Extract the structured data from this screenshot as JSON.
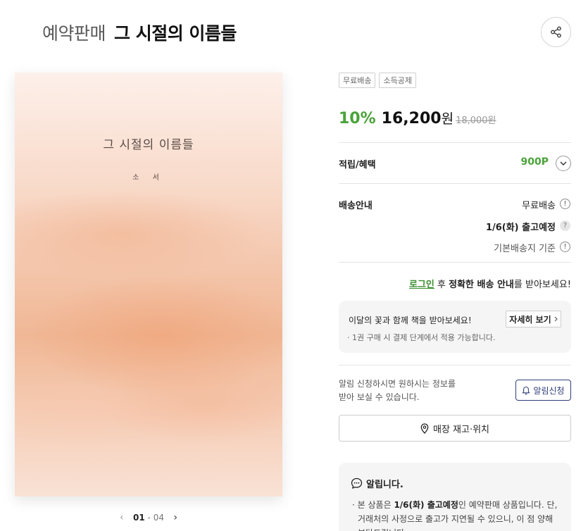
{
  "header": {
    "prefix": "예약판매",
    "title": "그 시절의 이름들"
  },
  "cover": {
    "title": "그 시절의 이름들",
    "author": "소 서"
  },
  "pager": {
    "current": "01",
    "separator": "-",
    "total": "04"
  },
  "badges": [
    "무료배송",
    "소득공제"
  ],
  "price": {
    "discount": "10%",
    "sale": "16,200",
    "currency": "원",
    "original": "18,000원"
  },
  "points": {
    "label": "적립/혜택",
    "value": "900P"
  },
  "shipping": {
    "label": "배송안내",
    "fee": "무료배송",
    "date": "1/6(화) 출고예정",
    "base": "기본배송지 기준"
  },
  "login_notice": {
    "link": "로그인",
    "after": "후",
    "bold": "정확한 배송 안내",
    "tail": "를 받아보세요!"
  },
  "flower": {
    "title": "이달의 꽃과 함께 책을 받아보세요!",
    "note": "· 1권 구매 시 결제 단계에서 적용 가능합니다.",
    "button": "자세히 보기"
  },
  "alarm": {
    "line1": "알림 신청하시면 원하시는 정보를",
    "line2": "받아 보실 수 있습니다.",
    "button": "알림신청"
  },
  "store": {
    "button": "매장 재고·위치"
  },
  "notice": {
    "title": "알립니다.",
    "prefix": "본 상품은",
    "bold": "1/6(화) 출고예정",
    "suffix": "인 예약판매 상품입니다. 단, 거래처의 사정으로 출고가 지연될 수 있으니, 이 점 양해 부탁드립니다."
  },
  "colors": {
    "accent_green": "#4aa339",
    "link_green": "#3a8e2f",
    "alarm_navy": "#2f3e7a"
  }
}
